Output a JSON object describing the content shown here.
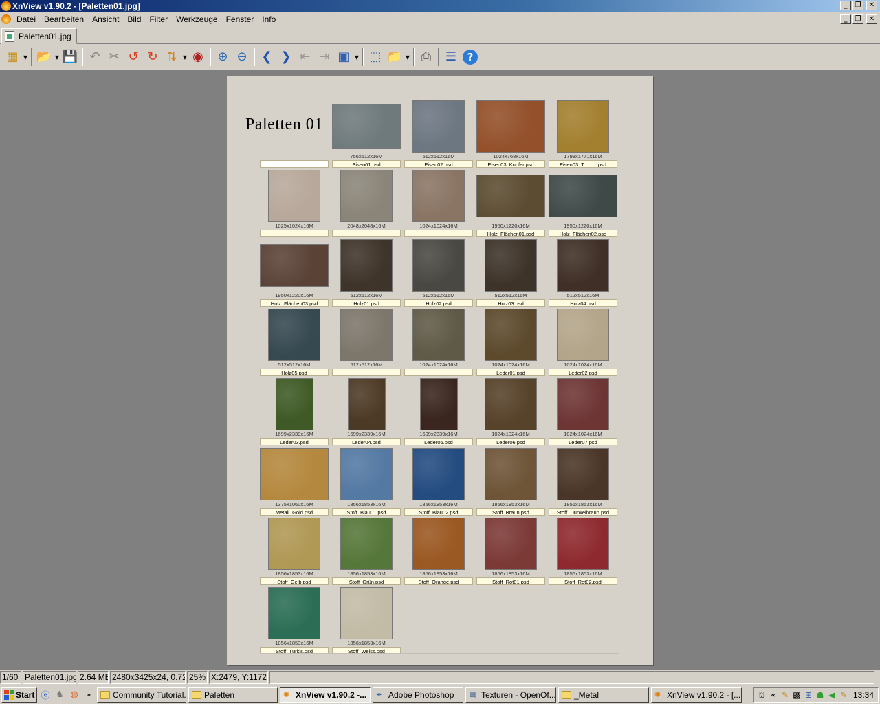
{
  "window": {
    "title": "XnView v1.90.2 - [Paletten01.jpg]"
  },
  "menu": [
    "Datei",
    "Bearbeiten",
    "Ansicht",
    "Bild",
    "Filter",
    "Werkzeuge",
    "Fenster",
    "Info"
  ],
  "tab": {
    "label": "Paletten01.jpg"
  },
  "toolbar_icons": [
    "browser-icon",
    "open-icon",
    "save-icon",
    "undo-icon",
    "cut-icon",
    "rotate-left-icon",
    "rotate-right-icon",
    "flip-icon",
    "eye-icon",
    "zoom-in-icon",
    "zoom-out-icon",
    "previous-icon",
    "next-icon",
    "first-icon",
    "last-icon",
    "slideshow-icon",
    "fullscreen-icon",
    "open-folder-icon",
    "print-icon",
    "properties-icon",
    "help-icon"
  ],
  "document": {
    "title": "Paletten 01",
    "parent_label": "..",
    "thumbnails": [
      {
        "dim": "756x512x16M",
        "name": "Eisen01.psd",
        "color": "#6f7a7c"
      },
      {
        "dim": "512x512x16M",
        "name": "Eisen02.psd",
        "color": "#6d7782"
      },
      {
        "dim": "1024x768x16M",
        "name": "Eisen03_Kupfer.psd",
        "color": "#93502a"
      },
      {
        "dim": "1798x1771x16M",
        "name": "Eisen03_T..........psd",
        "color": "#a38030"
      },
      {
        "dim": "1025x1024x16M",
        "name": "",
        "color": "#b8a89b"
      },
      {
        "dim": "2048x2048x16M",
        "name": "",
        "color": "#8b8579"
      },
      {
        "dim": "1024x1024x16M",
        "name": "",
        "color": "#8a7565"
      },
      {
        "dim": "1950x1220x16M",
        "name": "Holz_Flächen01.psd",
        "color": "#5c4c32"
      },
      {
        "dim": "1950x1220x16M",
        "name": "Holz_Flächen02.psd",
        "color": "#3f4a48"
      },
      {
        "dim": "1950x1220x16M",
        "name": "Holz_Flächen03.psd",
        "color": "#5a4237"
      },
      {
        "dim": "512x512x16M",
        "name": "Holz01.psd",
        "color": "#3f342a"
      },
      {
        "dim": "512x512x16M",
        "name": "Holz02.psd",
        "color": "#4a4842"
      },
      {
        "dim": "512x512x16M",
        "name": "Holz03.psd",
        "color": "#3d3329"
      },
      {
        "dim": "512x512x16M",
        "name": "Holz04.psd",
        "color": "#3f2f26"
      },
      {
        "dim": "512x512x16M",
        "name": "Holz05.psd",
        "color": "#364850"
      },
      {
        "dim": "512x512x16M",
        "name": "",
        "color": "#7d766b"
      },
      {
        "dim": "1024x1024x16M",
        "name": "",
        "color": "#5f5a47"
      },
      {
        "dim": "1024x1024x16M",
        "name": "Leder01.psd",
        "color": "#5d4a2d"
      },
      {
        "dim": "1024x1024x16M",
        "name": "Leder02.psd",
        "color": "#b3a58a"
      },
      {
        "dim": "1699x2339x16M",
        "name": "Leder03.psd",
        "color": "#3f5a26"
      },
      {
        "dim": "1699x2339x16M",
        "name": "Leder04.psd",
        "color": "#4d3a26"
      },
      {
        "dim": "1699x2339x16M",
        "name": "Leder05.psd",
        "color": "#3a261e"
      },
      {
        "dim": "1024x1024x16M",
        "name": "Leder06.psd",
        "color": "#57422a"
      },
      {
        "dim": "1024x1024x16M",
        "name": "Leder07.psd",
        "color": "#6e3535"
      },
      {
        "dim": "1375x1060x16M",
        "name": "Metall_Gold.psd",
        "color": "#b4883e"
      },
      {
        "dim": "1856x1853x16M",
        "name": "Stoff_Blau01.psd",
        "color": "#5479a3"
      },
      {
        "dim": "1856x1853x16M",
        "name": "Stoff_Blau02.psd",
        "color": "#244c80"
      },
      {
        "dim": "1856x1853x16M",
        "name": "Stoff_Braun.psd",
        "color": "#6e5538"
      },
      {
        "dim": "1856x1853x16M",
        "name": "Stoff_Dunkelbraun.psd",
        "color": "#4a3628"
      },
      {
        "dim": "1856x1853x16M",
        "name": "Stoff_Gelb.psd",
        "color": "#b09855"
      },
      {
        "dim": "1856x1853x16M",
        "name": "Stoff_Grün.psd",
        "color": "#56773a"
      },
      {
        "dim": "1856x1853x16M",
        "name": "Stoff_Orange.psd",
        "color": "#9a5822"
      },
      {
        "dim": "1856x1853x16M",
        "name": "Stoff_Rot01.psd",
        "color": "#7c3a37"
      },
      {
        "dim": "1856x1853x16M",
        "name": "Stoff_Rot02.psd",
        "color": "#8e2a2f"
      },
      {
        "dim": "1856x1853x16M",
        "name": "Stoff_Türkis.psd",
        "color": "#2c6e55"
      },
      {
        "dim": "1856x1853x16M",
        "name": "Stoff_Weiss.psd",
        "color": "#c2bba6"
      }
    ]
  },
  "status": {
    "index": "1/60",
    "filename": "Paletten01.jpg",
    "size": "2.64 MB",
    "dimensions": "2480x3425x24, 0.72",
    "zoom": "25%",
    "coords": "X:2479, Y:1172"
  },
  "taskbar": {
    "start": "Start",
    "tasks": [
      {
        "label": "Community Tutorial...",
        "icon": "folder-icon"
      },
      {
        "label": "Paletten",
        "icon": "folder-icon"
      },
      {
        "label": "XnView v1.90.2 -...",
        "icon": "xnview-icon",
        "active": true
      },
      {
        "label": "Adobe Photoshop",
        "icon": "photoshop-icon"
      },
      {
        "label": "Texturen - OpenOf...",
        "icon": "document-icon"
      },
      {
        "label": "_Metal",
        "icon": "folder-icon"
      },
      {
        "label": "XnView v1.90.2 - [...",
        "icon": "xnview-icon"
      }
    ],
    "clock": "13:34"
  }
}
